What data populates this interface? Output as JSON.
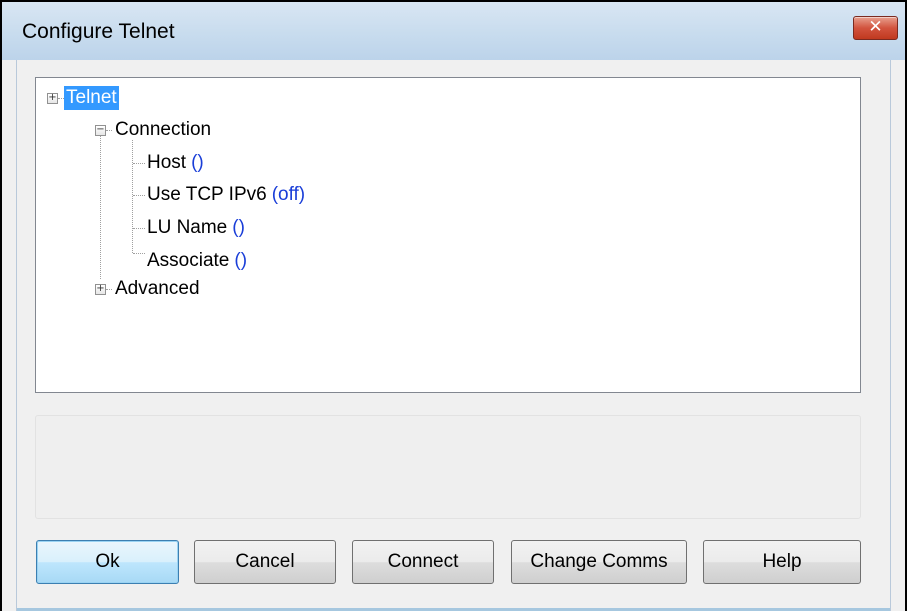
{
  "window": {
    "title": "Configure Telnet",
    "close_glyph": "✕"
  },
  "tree": {
    "root": {
      "label": "Telnet",
      "expander": "+",
      "selected": true
    },
    "connection": {
      "label": "Connection",
      "expander": "−",
      "items": [
        {
          "label": "Host",
          "value": "()"
        },
        {
          "label": "Use TCP IPv6",
          "value": "(off)"
        },
        {
          "label": "LU Name",
          "value": "()"
        },
        {
          "label": "Associate",
          "value": "()"
        }
      ]
    },
    "advanced": {
      "label": "Advanced",
      "expander": "+"
    }
  },
  "buttons": {
    "ok": "Ok",
    "cancel": "Cancel",
    "connect": "Connect",
    "change_comms": "Change Comms",
    "help": "Help"
  },
  "colors": {
    "selection": "#3399ff",
    "value_text": "#1a3ed8"
  }
}
